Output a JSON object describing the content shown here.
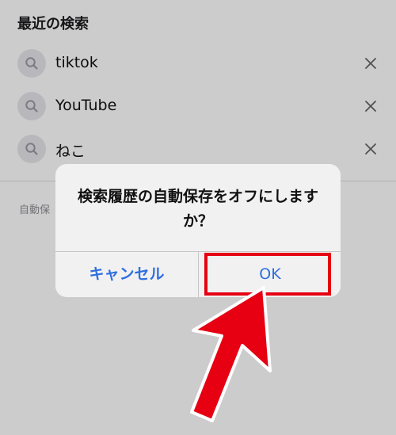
{
  "recent_searches": {
    "title": "最近の検索",
    "items": [
      {
        "label": "tiktok"
      },
      {
        "label": "YouTube"
      },
      {
        "label": "ねこ"
      }
    ]
  },
  "footer": {
    "text": "自動保"
  },
  "dialog": {
    "message": "検索履歴の自動保存をオフにしますか？",
    "cancel_label": "キャンセル",
    "ok_label": "OK"
  },
  "colors": {
    "accent": "#2f6ee0",
    "annotation": "#e60012"
  },
  "icons": {
    "search": "search-icon",
    "remove": "close-icon",
    "pointer": "arrow-annotation"
  }
}
